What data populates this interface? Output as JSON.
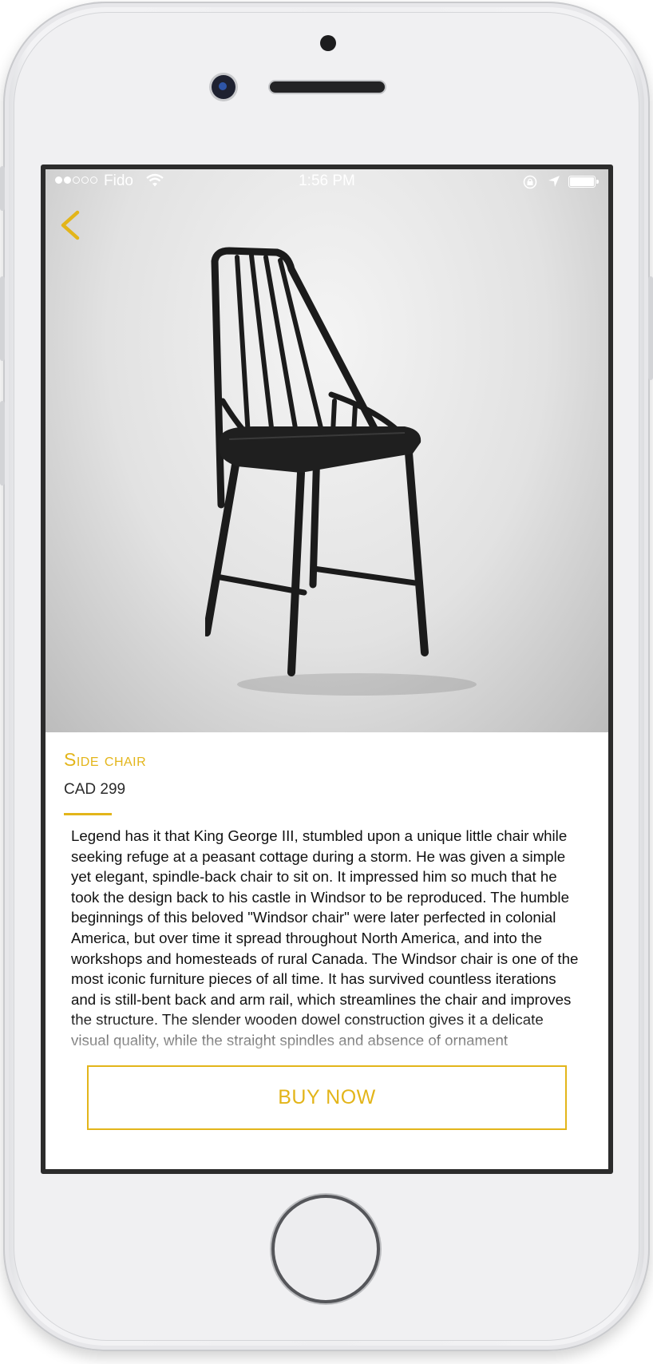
{
  "status_bar": {
    "carrier": "Fido",
    "time": "1:56 PM",
    "signal_strength": 2,
    "signal_max": 5
  },
  "product": {
    "title": "Side chair",
    "price": "CAD 299",
    "description": "Legend has it that King George III, stumbled upon a unique little chair while seeking refuge at a peasant cottage during a storm. He was given a simple yet elegant, spindle-back chair to sit on. It impressed him so much that he took the design back to his castle in Windsor to be reproduced. The humble beginnings of this beloved \"Windsor chair\" were later perfected in colonial America, but over time it spread throughout North America, and into the workshops and homesteads of rural Canada. The Windsor chair is one of the most iconic furniture pieces of all time. It has survived countless iterations and is still-bent back and arm rail, which streamlines the chair and improves the structure. The slender wooden dowel construction gives it a delicate visual quality, while the straight spindles and absence of ornament"
  },
  "actions": {
    "buy_label": "BUY NOW"
  },
  "icons": {
    "back": "chevron-left-icon",
    "wifi": "wifi-icon",
    "rotation_lock": "rotation-lock-icon",
    "location": "location-arrow-icon",
    "battery": "battery-icon"
  },
  "colors": {
    "accent": "#e3b51a",
    "text": "#111111",
    "price": "#2b2b2b"
  }
}
